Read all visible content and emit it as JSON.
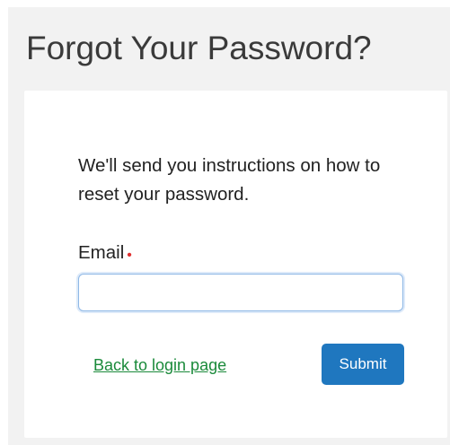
{
  "header": {
    "title": "Forgot Your Password?"
  },
  "form": {
    "instructions": "We'll send you instructions on how to reset your password.",
    "email_label": "Email",
    "required_mark": "•",
    "email_value": "",
    "email_placeholder": "",
    "back_link_label": "Back to login page",
    "submit_label": "Submit"
  },
  "colors": {
    "panel_background": "#f2f2f2",
    "link": "#1a8a3a",
    "submit_button": "#1f77bf",
    "required": "#e03030",
    "input_border": "#8fb8e6"
  }
}
